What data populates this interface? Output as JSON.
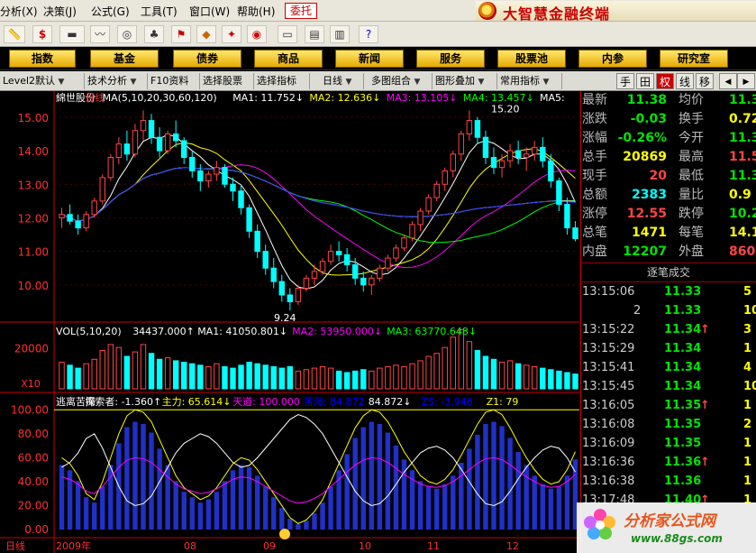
{
  "menu": {
    "items": [
      "分析(X)",
      "决策(J)",
      "公式(G)",
      "工具(T)",
      "窗口(W)",
      "帮助(H)"
    ],
    "weituo": "委托",
    "brand": "大智慧金融终端"
  },
  "nav": {
    "buttons": [
      "指数",
      "基金",
      "债券",
      "商品",
      "新闻",
      "服务",
      "股票池",
      "内参",
      "研究室"
    ]
  },
  "tabs": {
    "items": [
      "Level2默认",
      "技术分析",
      "F10资料",
      "选择股票",
      "选择指标",
      "日线",
      "多图组合",
      "图形叠加",
      "常用指标"
    ],
    "right": [
      "手",
      "田",
      "权",
      "线",
      "移"
    ]
  },
  "chart": {
    "stock_name": "綿世股份",
    "period": "日线",
    "ma_header": "MA(5,10,20,30,60,120)",
    "ma_values": [
      {
        "label": "MA1:",
        "value": "11.752",
        "arrow": "↓",
        "color": "#ffffff"
      },
      {
        "label": "MA2:",
        "value": "12.636",
        "arrow": "↓",
        "color": "#ffff00"
      },
      {
        "label": "MA3:",
        "value": "13.105",
        "arrow": "↓",
        "color": "#ff00ff"
      },
      {
        "label": "MA4:",
        "value": "13.457",
        "arrow": "↓",
        "color": "#00ff00"
      },
      {
        "label": "MA5:",
        "value": "",
        "arrow": "",
        "color": "#ffffff"
      }
    ],
    "price_ticks": [
      "15.00",
      "14.00",
      "13.00",
      "12.00",
      "11.00",
      "10.00"
    ],
    "high_label": "15.20",
    "low_label": "9.24",
    "vol_header": "VOL(5,10,20)",
    "vol_values": [
      {
        "label": "",
        "value": "34437.000",
        "arrow": "↑",
        "color": "#ffffff"
      },
      {
        "label": "MA1:",
        "value": "41050.801",
        "arrow": "↓",
        "color": "#ffffff"
      },
      {
        "label": "MA2:",
        "value": "53950.000",
        "arrow": "↓",
        "color": "#ff00ff"
      },
      {
        "label": "MA3:",
        "value": "63770.648",
        "arrow": "↓",
        "color": "#00ff00"
      }
    ],
    "vol_tick": "20000",
    "vol_unit": "X10",
    "ind_header": "逃离苦海",
    "ind_values": [
      {
        "label": "探索者:",
        "value": "-1.360",
        "arrow": "↑",
        "color": "#ffffff"
      },
      {
        "label": "主力:",
        "value": "65.614",
        "arrow": "↓",
        "color": "#ffff00"
      },
      {
        "label": "天道:",
        "value": "100.000",
        "arrow": "",
        "color": "#ff00ff"
      },
      {
        "label": "苦海:",
        "value": "84.872",
        "arrow": "",
        "color": "#0000ff"
      },
      {
        "label": "",
        "value": "84.872",
        "arrow": "↓",
        "color": "#ffffff"
      },
      {
        "label": "ZS:",
        "value": "-3.946",
        "arrow": "",
        "color": "#0000ff"
      },
      {
        "label": "Z1:",
        "value": "79",
        "arrow": "",
        "color": "#ffff00"
      }
    ],
    "ind_ticks": [
      "100.00",
      "80.00",
      "60.00",
      "40.00",
      "20.00",
      "0.00"
    ],
    "period_bottom": "日线",
    "date_labels": [
      "2009年",
      "08",
      "09",
      "10",
      "11",
      "12"
    ]
  },
  "chart_data": {
    "type": "candlestick",
    "price_ylim": [
      9.0,
      15.4
    ],
    "candles_ohlc": [
      [
        12.0,
        12.3,
        11.7,
        12.1
      ],
      [
        12.1,
        12.4,
        11.8,
        11.9
      ],
      [
        11.9,
        12.1,
        11.5,
        11.7
      ],
      [
        11.7,
        12.2,
        11.6,
        12.1
      ],
      [
        12.1,
        12.6,
        12.0,
        12.5
      ],
      [
        12.5,
        13.3,
        12.4,
        13.2
      ],
      [
        13.2,
        13.9,
        13.1,
        13.8
      ],
      [
        13.8,
        14.4,
        13.6,
        14.2
      ],
      [
        14.2,
        14.6,
        13.7,
        13.9
      ],
      [
        13.9,
        14.8,
        13.8,
        14.6
      ],
      [
        14.6,
        15.2,
        14.3,
        14.9
      ],
      [
        14.9,
        15.1,
        14.2,
        14.4
      ],
      [
        14.4,
        14.7,
        13.8,
        14.0
      ],
      [
        14.0,
        14.6,
        13.9,
        14.5
      ],
      [
        14.5,
        14.9,
        14.1,
        14.3
      ],
      [
        14.3,
        14.4,
        13.6,
        13.8
      ],
      [
        13.8,
        14.0,
        13.2,
        13.4
      ],
      [
        13.4,
        13.6,
        12.8,
        13.1
      ],
      [
        13.1,
        13.4,
        12.9,
        13.3
      ],
      [
        13.3,
        13.7,
        13.1,
        13.5
      ],
      [
        13.5,
        13.6,
        12.9,
        13.0
      ],
      [
        13.0,
        13.2,
        12.5,
        12.8
      ],
      [
        12.8,
        13.0,
        12.1,
        12.3
      ],
      [
        12.3,
        12.4,
        11.4,
        11.6
      ],
      [
        11.6,
        11.8,
        10.8,
        11.0
      ],
      [
        11.0,
        11.2,
        10.3,
        10.5
      ],
      [
        10.5,
        10.8,
        9.9,
        10.1
      ],
      [
        10.1,
        10.3,
        9.5,
        9.7
      ],
      [
        9.7,
        9.9,
        9.24,
        9.5
      ],
      [
        9.5,
        10.0,
        9.4,
        9.9
      ],
      [
        9.9,
        10.3,
        9.8,
        10.2
      ],
      [
        10.2,
        10.6,
        10.0,
        10.4
      ],
      [
        10.4,
        10.8,
        10.3,
        10.7
      ],
      [
        10.7,
        11.2,
        10.6,
        11.0
      ],
      [
        11.0,
        11.3,
        10.7,
        10.9
      ],
      [
        10.9,
        11.1,
        10.4,
        10.6
      ],
      [
        10.6,
        10.8,
        10.0,
        10.2
      ],
      [
        10.2,
        10.4,
        9.8,
        10.0
      ],
      [
        10.0,
        10.3,
        9.7,
        10.2
      ],
      [
        10.2,
        10.6,
        10.1,
        10.5
      ],
      [
        10.5,
        10.9,
        10.4,
        10.8
      ],
      [
        10.8,
        11.2,
        10.7,
        11.1
      ],
      [
        11.1,
        11.5,
        11.0,
        11.4
      ],
      [
        11.4,
        11.9,
        11.3,
        11.8
      ],
      [
        11.8,
        12.3,
        11.6,
        12.2
      ],
      [
        12.2,
        12.7,
        12.1,
        12.6
      ],
      [
        12.6,
        13.1,
        12.5,
        13.0
      ],
      [
        13.0,
        13.5,
        12.8,
        13.4
      ],
      [
        13.4,
        14.0,
        13.2,
        13.9
      ],
      [
        13.9,
        14.6,
        13.7,
        14.5
      ],
      [
        14.5,
        15.2,
        14.3,
        14.9
      ],
      [
        14.9,
        15.0,
        14.2,
        14.4
      ],
      [
        14.4,
        14.6,
        13.6,
        13.8
      ],
      [
        13.8,
        14.1,
        13.3,
        13.5
      ],
      [
        13.5,
        13.9,
        13.2,
        13.7
      ],
      [
        13.7,
        14.2,
        13.5,
        14.0
      ],
      [
        14.0,
        14.3,
        13.6,
        13.8
      ],
      [
        13.8,
        14.1,
        13.4,
        13.9
      ],
      [
        13.9,
        14.3,
        13.7,
        14.1
      ],
      [
        14.1,
        14.4,
        13.5,
        13.7
      ],
      [
        13.7,
        13.9,
        12.9,
        13.1
      ],
      [
        13.1,
        13.2,
        12.2,
        12.4
      ],
      [
        12.4,
        12.6,
        11.5,
        11.7
      ],
      [
        11.7,
        11.9,
        11.3,
        11.38
      ]
    ],
    "volume": [
      18,
      16,
      14,
      17,
      20,
      26,
      30,
      28,
      22,
      25,
      30,
      24,
      20,
      21,
      19,
      18,
      17,
      16,
      15,
      17,
      15,
      14,
      16,
      18,
      17,
      16,
      15,
      14,
      15,
      12,
      13,
      14,
      15,
      14,
      12,
      11,
      12,
      13,
      12,
      14,
      15,
      16,
      15,
      17,
      19,
      22,
      24,
      28,
      35,
      40,
      32,
      26,
      22,
      20,
      18,
      19,
      17,
      16,
      15,
      14,
      13,
      12,
      11,
      10
    ],
    "indicator_ylim": [
      0,
      110
    ],
    "zhuli": [
      60,
      55,
      45,
      30,
      25,
      40,
      60,
      80,
      95,
      100,
      98,
      90,
      75,
      60,
      45,
      35,
      30,
      25,
      28,
      35,
      45,
      55,
      60,
      58,
      50,
      40,
      30,
      20,
      10,
      5,
      8,
      15,
      25,
      40,
      55,
      70,
      85,
      95,
      100,
      98,
      90,
      78,
      65,
      55,
      45,
      40,
      38,
      42,
      50,
      62,
      75,
      88,
      98,
      100,
      96,
      85,
      72,
      60,
      50,
      42,
      38,
      40,
      50,
      65
    ],
    "x_labels": [
      "2009年",
      "08",
      "09",
      "10",
      "11",
      "12"
    ]
  },
  "quote": {
    "rows": [
      {
        "l": "最新",
        "v": "11.38",
        "vc": "#00e400",
        "l2": "均价",
        "v2": "11.31",
        "v2c": "#00e400"
      },
      {
        "l": "涨跌",
        "v": "-0.03",
        "vc": "#00e400",
        "l2": "换手",
        "v2": "0.72",
        "v2c": "#ffff00"
      },
      {
        "l": "涨幅",
        "v": "-0.26%",
        "vc": "#00e400",
        "l2": "今开",
        "v2": "11.3",
        "v2c": "#00e400"
      },
      {
        "l": "总手",
        "v": "20869",
        "vc": "#ffff00",
        "l2": "最高",
        "v2": "11.5",
        "v2c": "#ff4545"
      },
      {
        "l": "现手",
        "v": "20",
        "vc": "#ff4545",
        "l2": "最低",
        "v2": "11.3",
        "v2c": "#00e400"
      },
      {
        "l": "总额",
        "v": "2383",
        "vc": "#00ffff",
        "l2": "量比",
        "v2": "0.9",
        "v2c": "#ffff00"
      },
      {
        "l": "涨停",
        "v": "12.55",
        "vc": "#ff4545",
        "l2": "跌停",
        "v2": "10.2",
        "v2c": "#00e400"
      },
      {
        "l": "总笔",
        "v": "1471",
        "vc": "#ffff00",
        "l2": "每笔",
        "v2": "14.1",
        "v2c": "#ffff00"
      },
      {
        "l": "内盘",
        "v": "12207",
        "vc": "#00e400",
        "l2": "外盘",
        "v2": "860",
        "v2c": "#ff4545"
      }
    ]
  },
  "ticks": {
    "header": "逐笔成交",
    "rows": [
      {
        "t": "13:15:06",
        "p": "11.33",
        "pc": "#00e400",
        "a": "",
        "v": "5"
      },
      {
        "t": "2",
        "p": "11.33",
        "pc": "#00e400",
        "a": "",
        "v": "10"
      },
      {
        "t": "13:15:22",
        "p": "11.34",
        "pc": "#00e400",
        "a": "↑",
        "v": "3"
      },
      {
        "t": "13:15:29",
        "p": "11.34",
        "pc": "#00e400",
        "a": "",
        "v": "1"
      },
      {
        "t": "13:15:41",
        "p": "11.34",
        "pc": "#00e400",
        "a": "",
        "v": "4"
      },
      {
        "t": "13:15:45",
        "p": "11.34",
        "pc": "#00e400",
        "a": "",
        "v": "10"
      },
      {
        "t": "13:16:05",
        "p": "11.35",
        "pc": "#00e400",
        "a": "↑",
        "v": "1"
      },
      {
        "t": "13:16:08",
        "p": "11.35",
        "pc": "#00e400",
        "a": "",
        "v": "2"
      },
      {
        "t": "13:16:09",
        "p": "11.35",
        "pc": "#00e400",
        "a": "",
        "v": "1"
      },
      {
        "t": "13:16:36",
        "p": "11.36",
        "pc": "#00e400",
        "a": "↑",
        "v": "1"
      },
      {
        "t": "13:16:38",
        "p": "11.36",
        "pc": "#00e400",
        "a": "",
        "v": "1"
      },
      {
        "t": "13:17:48",
        "p": "11.40",
        "pc": "#00e400",
        "a": "↑",
        "v": "1"
      }
    ]
  },
  "watermark": {
    "line1": "分析家公式网",
    "line2": "www.88gs.com"
  }
}
